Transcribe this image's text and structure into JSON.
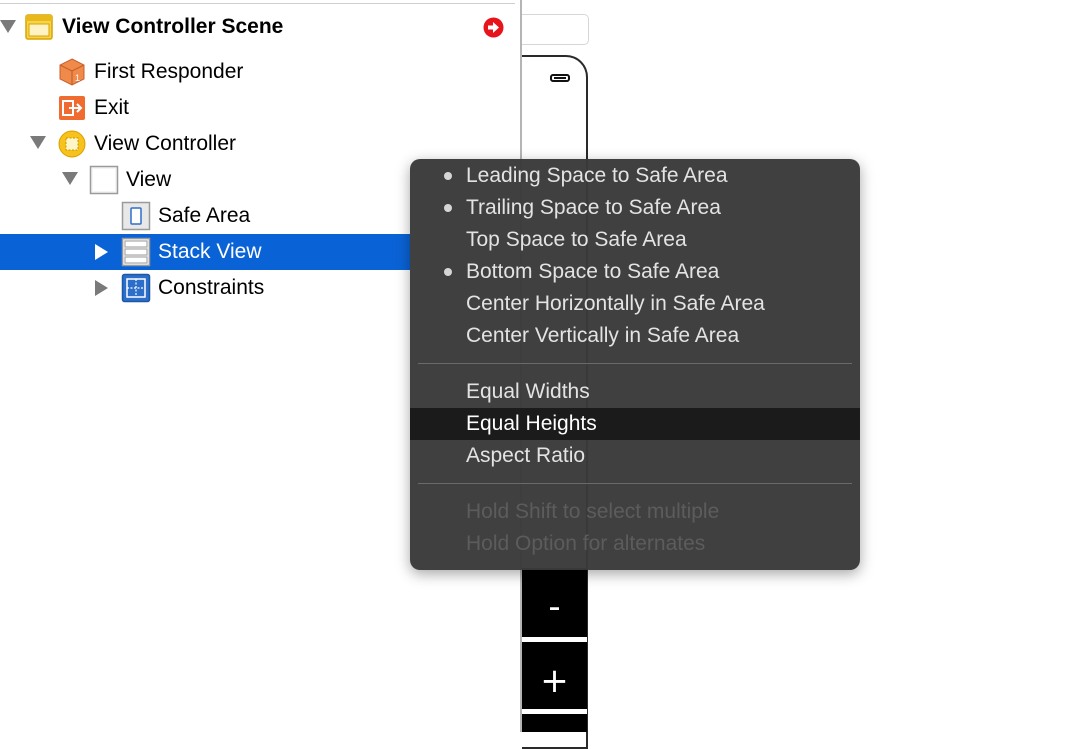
{
  "outline": {
    "scene_title": "View Controller Scene",
    "items": [
      {
        "label": "First Responder"
      },
      {
        "label": "Exit"
      },
      {
        "label": "View Controller"
      },
      {
        "label": "View"
      },
      {
        "label": "Safe Area"
      },
      {
        "label": "Stack View"
      },
      {
        "label": "Constraints"
      }
    ],
    "selected": "Stack View",
    "colors": {
      "selection": "#0a63d6",
      "warning": "#e8141c"
    }
  },
  "canvas": {
    "stepper": {
      "minus_label": "-",
      "plus_label": "+"
    }
  },
  "menu": {
    "group1": [
      {
        "label": "Leading Space to Safe Area",
        "checked": true
      },
      {
        "label": "Trailing Space to Safe Area",
        "checked": true
      },
      {
        "label": "Top Space to Safe Area",
        "checked": false
      },
      {
        "label": "Bottom Space to Safe Area",
        "checked": true
      },
      {
        "label": "Center Horizontally in Safe Area",
        "checked": false
      },
      {
        "label": "Center Vertically in Safe Area",
        "checked": false
      }
    ],
    "group2": [
      {
        "label": "Equal Widths"
      },
      {
        "label": "Equal Heights"
      },
      {
        "label": "Aspect Ratio"
      }
    ],
    "highlighted": "Equal Heights",
    "hints": [
      {
        "label": "Hold Shift to select multiple"
      },
      {
        "label": "Hold Option for alternates"
      }
    ]
  }
}
